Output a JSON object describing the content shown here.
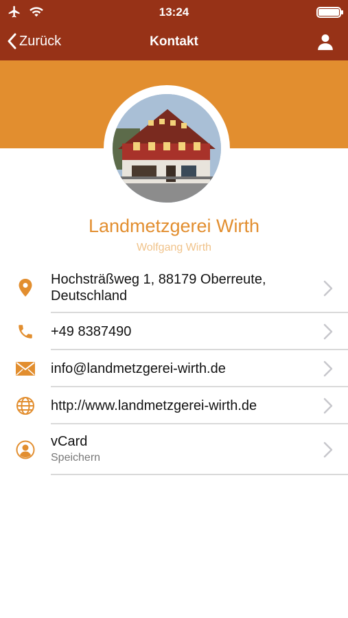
{
  "status_bar": {
    "time": "13:24"
  },
  "nav": {
    "back_label": "Zurück",
    "title": "Kontakt"
  },
  "profile": {
    "company": "Landmetzgerei Wirth",
    "person": "Wolfgang Wirth"
  },
  "contacts": [
    {
      "icon": "location-pin-icon",
      "line1": "Hochsträßweg 1, 88179 Oberreute,",
      "line2": "Deutschland"
    },
    {
      "icon": "phone-icon",
      "text": "+49 8387490"
    },
    {
      "icon": "mail-icon",
      "text": "info@landmetzgerei-wirth.de"
    },
    {
      "icon": "globe-icon",
      "text": "http://www.landmetzgerei-wirth.de"
    },
    {
      "icon": "vcard-icon",
      "text": "vCard",
      "sub": "Speichern"
    }
  ],
  "colors": {
    "bar": "#973217",
    "accent": "#e28e2f",
    "subtitle": "#f0c289"
  }
}
